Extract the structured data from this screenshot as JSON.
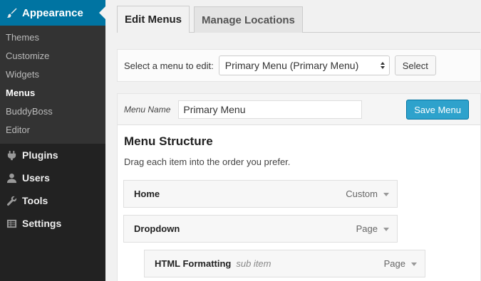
{
  "sidebar": {
    "active": {
      "label": "Appearance",
      "icon": "paintbrush-icon"
    },
    "submenu": [
      "Themes",
      "Customize",
      "Widgets",
      "Menus",
      "BuddyBoss",
      "Editor"
    ],
    "current_sub": "Menus",
    "items": [
      {
        "label": "Plugins",
        "icon": "plug-icon"
      },
      {
        "label": "Users",
        "icon": "user-icon"
      },
      {
        "label": "Tools",
        "icon": "wrench-icon"
      },
      {
        "label": "Settings",
        "icon": "settings-icon"
      }
    ]
  },
  "tabs": {
    "edit": "Edit Menus",
    "manage": "Manage Locations"
  },
  "select_bar": {
    "label": "Select a menu to edit:",
    "selected": "Primary Menu (Primary Menu)",
    "button": "Select"
  },
  "editor": {
    "name_label": "Menu Name",
    "name_value": "Primary Menu",
    "save": "Save Menu",
    "structure_title": "Menu Structure",
    "structure_desc": "Drag each item into the order you prefer."
  },
  "menu_items": [
    {
      "title": "Home",
      "sub": "",
      "type": "Custom"
    },
    {
      "title": "Dropdown",
      "sub": "",
      "type": "Page"
    },
    {
      "title": "HTML Formatting",
      "sub": "sub item",
      "type": "Page"
    }
  ]
}
